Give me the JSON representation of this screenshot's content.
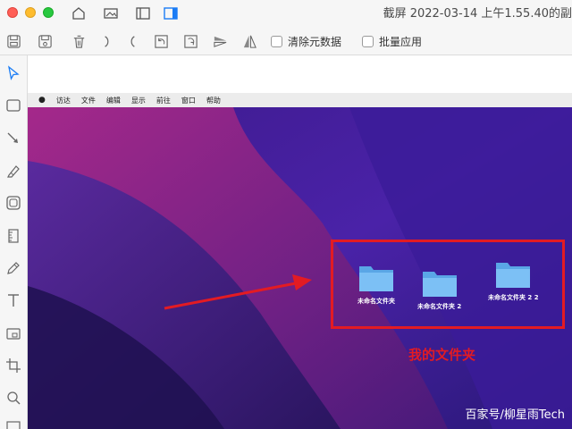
{
  "window": {
    "title": "截屏 2022-03-14 上午1.55.40的副"
  },
  "titlebar_icons": [
    "home-icon",
    "image-icon",
    "sidebar-left-icon",
    "sidebar-right-icon"
  ],
  "toolbar": {
    "tools": [
      "save-icon",
      "save-as-icon",
      "trash-icon",
      "undo-icon",
      "redo-icon",
      "rotate-left-icon",
      "rotate-right-icon",
      "flip-vertical-icon",
      "flip-horizontal-icon"
    ],
    "clear_metadata_label": "清除元数据",
    "batch_apply_label": "批量应用"
  },
  "sidebar": {
    "tools": [
      "pointer-icon",
      "rectangle-icon",
      "arrow-icon",
      "highlighter-icon",
      "rounded-rect-icon",
      "ruler-icon",
      "pencil-icon",
      "text-icon",
      "mosaic-icon",
      "crop-icon",
      "magnifier-icon",
      "layers-icon"
    ]
  },
  "screenshot": {
    "menubar": {
      "items": [
        "访达",
        "文件",
        "编辑",
        "显示",
        "前往",
        "窗口",
        "帮助"
      ]
    },
    "folders": [
      {
        "label": "未命名文件夹"
      },
      {
        "label": "未命名文件夹 2"
      },
      {
        "label": "未命名文件夹 2 2"
      }
    ],
    "annotation_text": "我的文件夹",
    "watermark": "百家号/柳星雨Tech"
  },
  "colors": {
    "annotation": "#e31b23",
    "folder": "#6fb3ee",
    "desktop_dark": "#1e1150",
    "desktop_mid": "#5c2ca6"
  }
}
